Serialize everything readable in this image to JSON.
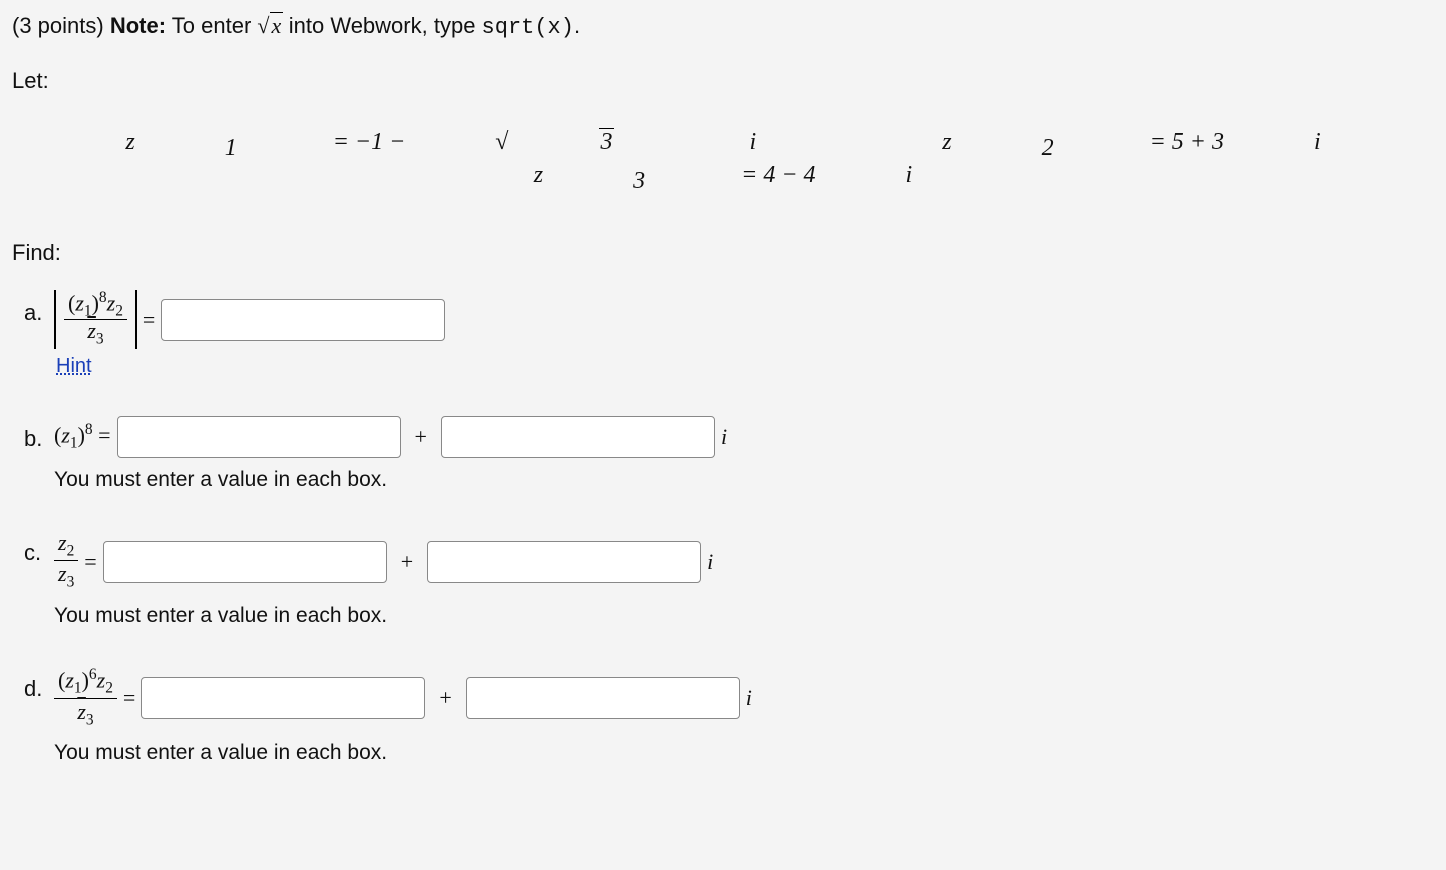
{
  "header": {
    "points_label": "(3 points)",
    "note_label": "Note:",
    "note_prefix": "To enter",
    "note_sqrt_sym_pre": "√",
    "note_sqrt_arg": "x",
    "note_mid": " into Webwork, type ",
    "note_code": "sqrt(x)",
    "note_period": "."
  },
  "let_label": "Let:",
  "given": {
    "z1": "z₁ = −1 − √3 i",
    "z2": "z₂ = 5 + 3i",
    "z3": "z₃ = 4 − 4i"
  },
  "find_label": "Find:",
  "parts": {
    "a": {
      "marker": "a.",
      "num_html": "(z₁)⁸ z₂",
      "den_html": "z̄₃",
      "eq": "=",
      "hint": "Hint"
    },
    "b": {
      "marker": "b.",
      "lhs": "(z₁)⁸ =",
      "plus": "+",
      "i": "i",
      "help": "You must enter a value in each box."
    },
    "c": {
      "marker": "c.",
      "num": "z₂",
      "den": "z₃",
      "eq": "=",
      "plus": "+",
      "i": "i",
      "help": "You must enter a value in each box."
    },
    "d": {
      "marker": "d.",
      "num": "(z₁)⁶ z₂",
      "den": "z̄₃",
      "eq": "=",
      "plus": "+",
      "i": "i",
      "help": "You must enter a value in each box."
    }
  }
}
